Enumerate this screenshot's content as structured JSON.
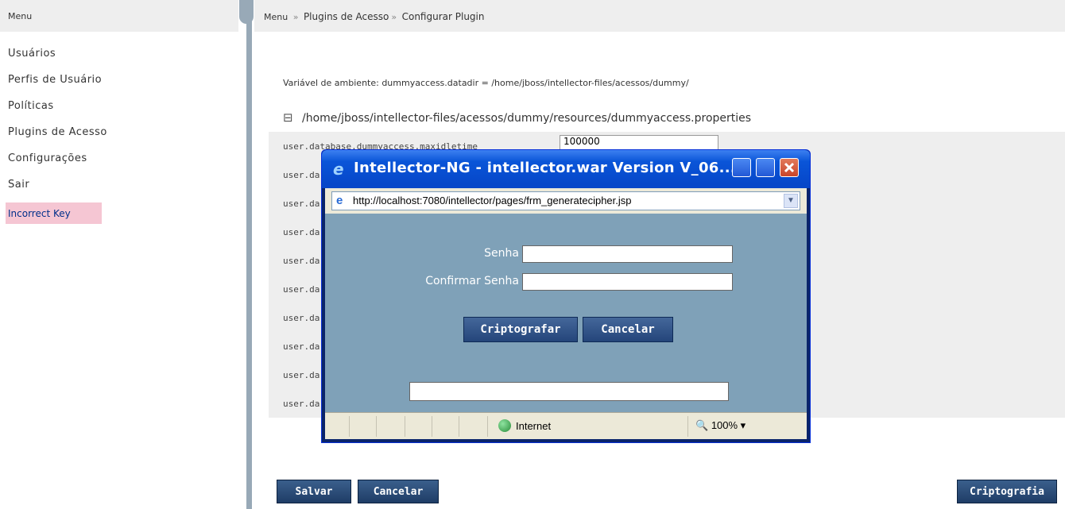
{
  "menu": {
    "header": "Menu",
    "items": [
      "Usuários",
      "Perfis de Usuário",
      "Políticas",
      "Plugins de Acesso",
      "Configurações",
      "Sair"
    ],
    "error_badge": "Incorrect Key"
  },
  "breadcrumb": {
    "root": "Menu",
    "sep": "»",
    "level1": "Plugins de Acesso",
    "level2": "Configurar Plugin"
  },
  "env_var": "Variável de ambiente: dummyaccess.datadir = /home/jboss/intellector-files/acessos/dummy/",
  "properties_file": "/home/jboss/intellector-files/acessos/dummy/resources/dummyaccess.properties",
  "properties": {
    "first_key": "user.database.dummyaccess.maxidletime",
    "first_value": "100000",
    "row_prefixes": [
      "user.da",
      "user.da",
      "user.da",
      "user.da",
      "user.da",
      "user.da",
      "user.da",
      "user.da",
      "user.da"
    ]
  },
  "buttons": {
    "save": "Salvar",
    "cancel": "Cancelar",
    "encrypt": "Criptografia"
  },
  "popup": {
    "title": "Intellector-NG - intellector.war Version V_06...",
    "url": "http://localhost:7080/intellector/pages/frm_generatecipher.jsp",
    "password_label": "Senha",
    "confirm_label": "Confirmar Senha",
    "encrypt_button": "Criptografar",
    "cancel_button": "Cancelar",
    "zone": "Internet",
    "zoom": "100%"
  },
  "colors": {
    "menu_bg": "#eeeeee",
    "error_bg": "#f5c6d3",
    "popup_content": "#7fa1b8",
    "title_bar": "#0a55d8"
  }
}
